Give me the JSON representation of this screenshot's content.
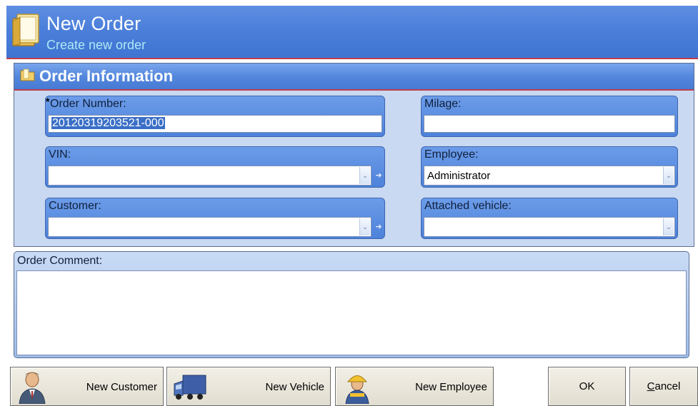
{
  "header": {
    "title": "New Order",
    "subtitle": "Create new order",
    "icon": "folder-book-icon"
  },
  "order_info": {
    "title": "Order Information",
    "icon": "folder-icon",
    "fields": {
      "order_number": {
        "label": "Order Number:",
        "required_marker": "*",
        "value": "20120319203521-000"
      },
      "milage": {
        "label": "Milage:",
        "value": ""
      },
      "vin": {
        "label": "VIN:",
        "value": ""
      },
      "employee": {
        "label": "Employee:",
        "value": "Administrator"
      },
      "customer": {
        "label": "Customer:",
        "value": ""
      },
      "attached_vehicle": {
        "label": "Attached vehicle:",
        "value": ""
      }
    }
  },
  "comment": {
    "label": "Order Comment:",
    "value": ""
  },
  "buttons": {
    "new_customer": "New Customer",
    "new_vehicle": "New Vehicle",
    "new_employee": "New Employee",
    "ok": "OK",
    "cancel": "Cancel"
  },
  "colors": {
    "header_blue": "#4b7fda",
    "subtitle_cyan": "#aee8f4",
    "accent_red": "#c0404a",
    "panel_bg": "#c9d9f1"
  }
}
